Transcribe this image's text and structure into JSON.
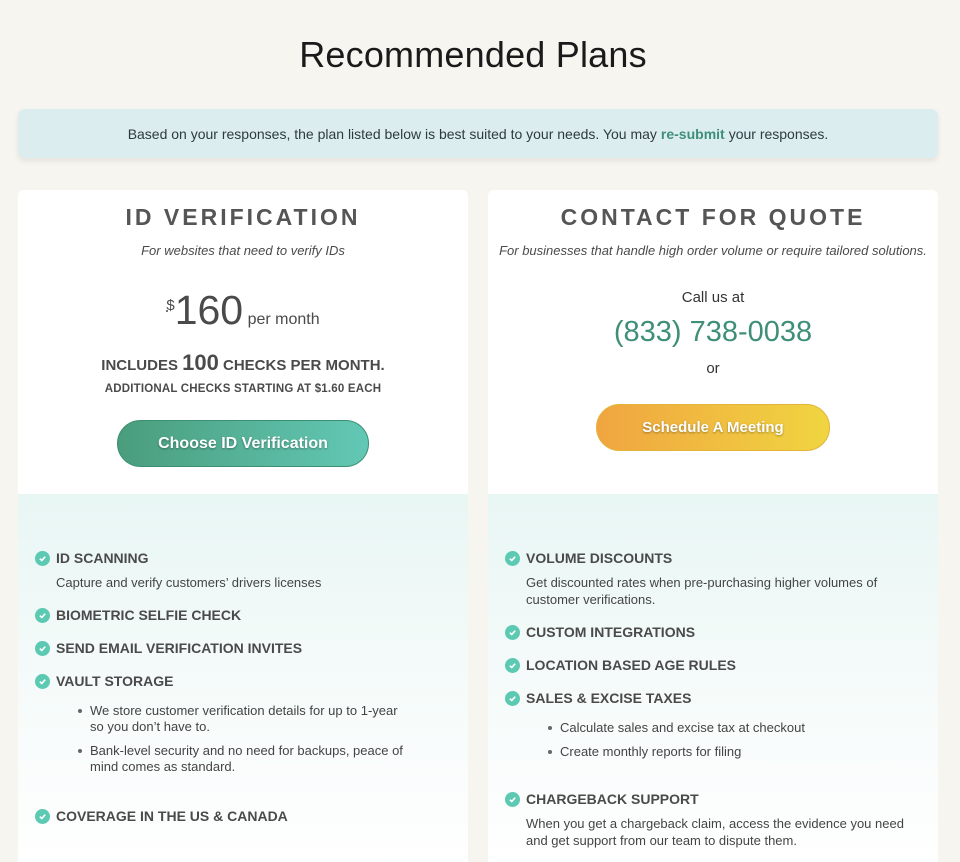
{
  "page_title": "Recommended Plans",
  "notice": {
    "before": "Based on your responses, the plan listed below is best suited to your needs. You may",
    "link": "re-submit",
    "after": "your responses."
  },
  "plan_id": {
    "title": "ID VERIFICATION",
    "subtitle": "For websites that need to verify IDs",
    "currency": "$",
    "price": "160",
    "period": "per month",
    "includes_prefix": "INCLUDES",
    "includes_count": "100",
    "includes_suffix": "CHECKS PER MONTH.",
    "additional": "ADDITIONAL CHECKS STARTING AT $1.60 EACH",
    "button": "Choose ID Verification",
    "features": {
      "f1_title": "ID SCANNING",
      "f1_desc": "Capture and verify customers’ drivers licenses",
      "f2_title": "BIOMETRIC SELFIE CHECK",
      "f3_title": "SEND EMAIL VERIFICATION INVITES",
      "f4_title": "VAULT STORAGE",
      "f4_items": [
        "We store customer verification details for up to 1-year so you don’t have to.",
        "Bank-level security and no need for backups, peace of mind comes as standard."
      ],
      "f5_title": "COVERAGE IN THE US & CANADA"
    }
  },
  "plan_quote": {
    "title": "CONTACT FOR QUOTE",
    "subtitle": "For businesses that handle high order volume or require tailored solutions.",
    "call_label": "Call us at",
    "phone": "(833) 738-0038",
    "or": "or",
    "button": "Schedule A Meeting",
    "features": {
      "f1_title": "VOLUME DISCOUNTS",
      "f1_desc": "Get discounted rates when pre-purchasing higher volumes of customer verifications.",
      "f2_title": "CUSTOM INTEGRATIONS",
      "f3_title": "LOCATION BASED AGE RULES",
      "f4_title": "SALES & EXCISE TAXES",
      "f4_items": [
        "Calculate sales and excise tax at checkout",
        "Create monthly reports for filing"
      ],
      "f5_title": "CHARGEBACK SUPPORT",
      "f5_desc": "When you get a chargeback claim, access the evidence you need and get support from our team to dispute them."
    }
  },
  "colors": {
    "accent_green": "#3f8f78",
    "check_teal": "#5cc9b2",
    "meeting_orange": "#f0a540",
    "meeting_yellow": "#f0d540"
  },
  "icons": {
    "feature_check": "check-circle-icon"
  }
}
